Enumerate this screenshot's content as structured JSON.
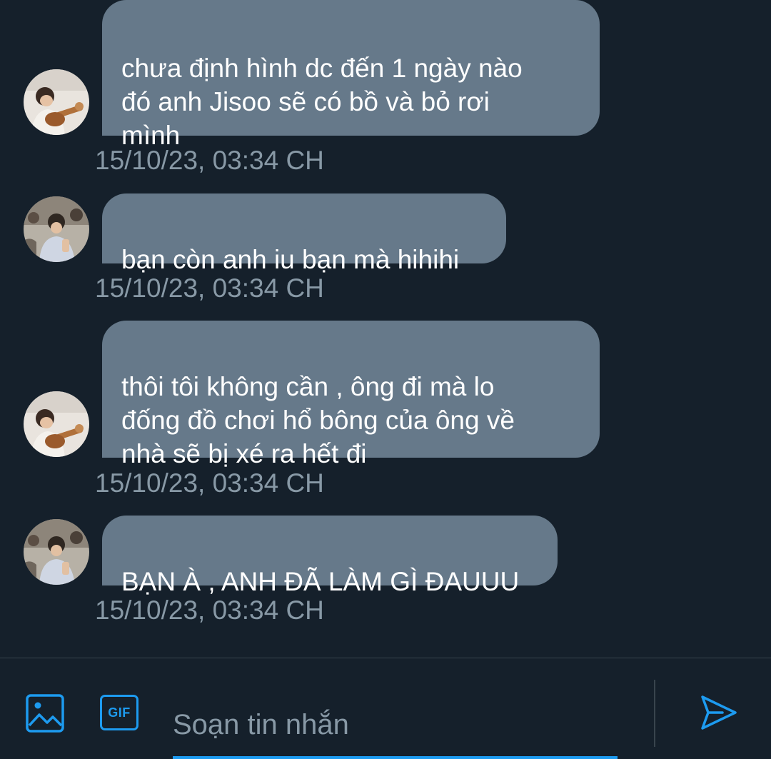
{
  "theme": {
    "background": "#15202b",
    "bubble": "#66798a",
    "text": "#ffffff",
    "muted": "#8899a6",
    "accent": "#1d9bf0",
    "divider": "#38444d"
  },
  "messages": [
    {
      "avatar": "avatar-guitar",
      "text": "chưa định hình dc đến 1 ngày nào\nđó anh Jisoo sẽ có bồ và bỏ rơi\nmình",
      "timestamp": "15/10/23, 03:34 CH"
    },
    {
      "avatar": "avatar-crowd",
      "text": "bạn còn anh iu bạn mà hihihi",
      "timestamp": "15/10/23, 03:34 CH"
    },
    {
      "avatar": "avatar-guitar",
      "text": "thôi tôi không cần , ông đi mà lo\nđống đồ chơi hổ bông của ông về\nnhà sẽ bị xé ra hết đi",
      "timestamp": "15/10/23, 03:34 CH"
    },
    {
      "avatar": "avatar-crowd",
      "text": "BẠN À  , ANH ĐÃ LÀM GÌ ĐAUUU",
      "timestamp": "15/10/23, 03:34 CH"
    }
  ],
  "composer": {
    "image_icon": "image-icon",
    "gif_label": "GIF",
    "placeholder": "Soạn tin nhắn",
    "send_icon": "send-icon"
  }
}
